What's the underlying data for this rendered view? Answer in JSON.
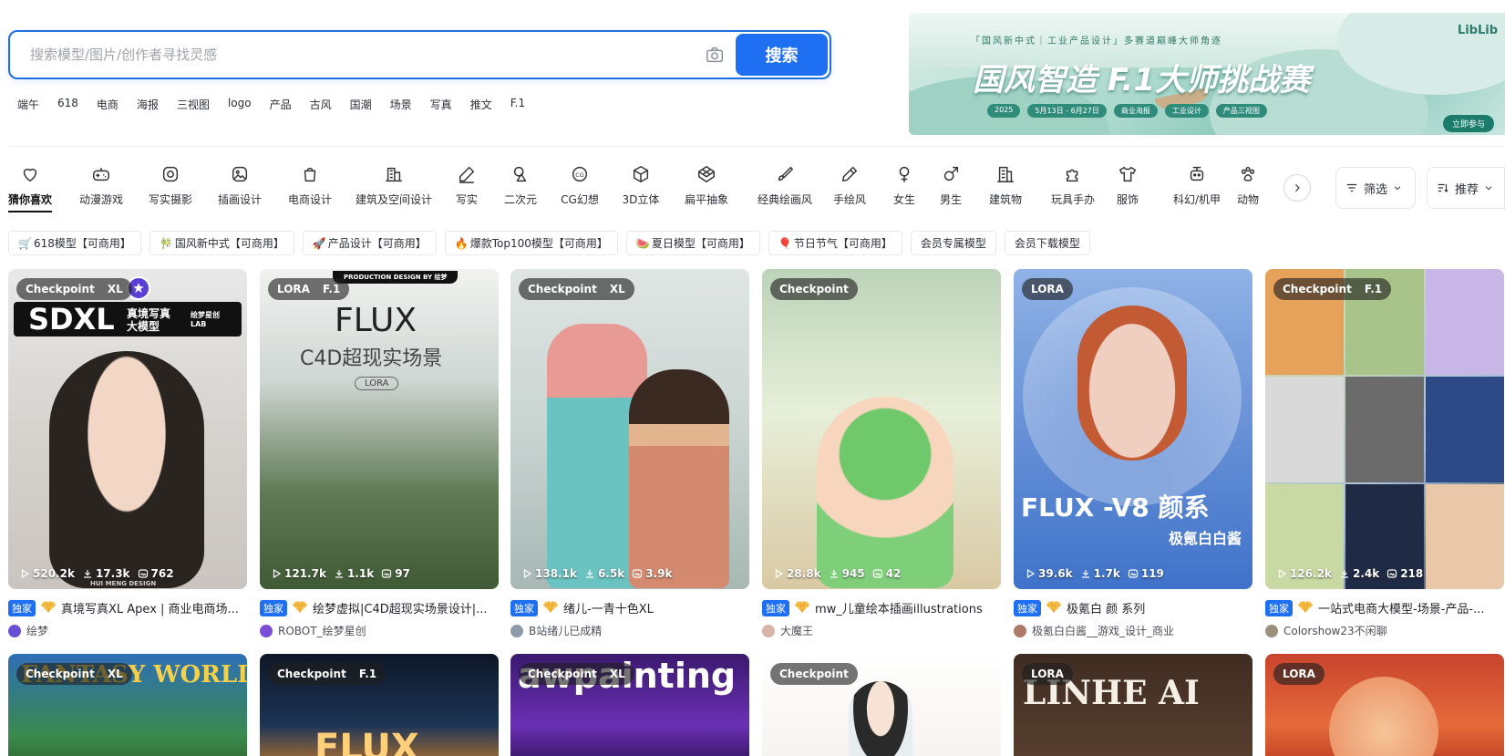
{
  "search": {
    "placeholder": "搜索模型/图片/创作者寻找灵感",
    "button": "搜索",
    "hot_words": [
      "端午",
      "618",
      "电商",
      "海报",
      "三视图",
      "logo",
      "产品",
      "古风",
      "国潮",
      "场景",
      "写真",
      "推文",
      "F.1"
    ]
  },
  "banner": {
    "top_line": "「国风新中式｜工业产品设计」多赛道巅峰大师角逐",
    "title": "国风智造 F.1大师挑战赛",
    "tags": [
      "2025",
      "5月13日 - 6月27日",
      "商业海报",
      "工业设计",
      "产品三视图"
    ],
    "logo": "LibLib",
    "cta": "立即参与"
  },
  "categories": [
    {
      "label": "猜你喜欢",
      "icon": "heart-icon",
      "active": true
    },
    {
      "label": "动漫游戏",
      "icon": "gamepad-icon"
    },
    {
      "label": "写实摄影",
      "icon": "camera-icon"
    },
    {
      "label": "插画设计",
      "icon": "picture-icon"
    },
    {
      "label": "电商设计",
      "icon": "shopping-bag-icon"
    },
    {
      "label": "建筑及空间设计",
      "icon": "building-icon"
    },
    {
      "label": "写实",
      "icon": "pencil-icon"
    },
    {
      "label": "二次元",
      "icon": "shapes-icon"
    },
    {
      "label": "CG幻想",
      "icon": "cg-icon"
    },
    {
      "label": "3D立体",
      "icon": "cube-icon"
    },
    {
      "label": "扁平抽象",
      "icon": "flat-cube-icon"
    },
    {
      "label": "经典绘画风",
      "icon": "brush-icon"
    },
    {
      "label": "手绘风",
      "icon": "pen-icon"
    },
    {
      "label": "女生",
      "icon": "female-icon"
    },
    {
      "label": "男生",
      "icon": "male-icon"
    },
    {
      "label": "建筑物",
      "icon": "office-building-icon"
    },
    {
      "label": "玩具手办",
      "icon": "puzzle-icon"
    },
    {
      "label": "服饰",
      "icon": "tshirt-icon"
    },
    {
      "label": "科幻/机甲",
      "icon": "robot-icon"
    },
    {
      "label": "动物",
      "icon": "paw-icon"
    }
  ],
  "controls": {
    "filter": "筛选",
    "sort": "推荐"
  },
  "tags": [
    {
      "emoji": "🛒",
      "label": "618模型【可商用】"
    },
    {
      "emoji": "🎋",
      "label": "国风新中式【可商用】"
    },
    {
      "emoji": "🚀",
      "label": "产品设计【可商用】"
    },
    {
      "emoji": "🔥",
      "label": "爆款Top100模型【可商用】"
    },
    {
      "emoji": "🍉",
      "label": "夏日模型【可商用】"
    },
    {
      "emoji": "🎈",
      "label": "节日节气【可商用】"
    },
    {
      "emoji": "",
      "label": "会员专属模型"
    },
    {
      "emoji": "",
      "label": "会员下载模型"
    }
  ],
  "cards": [
    {
      "badge": "Checkpoint",
      "sub": "XL",
      "views": "520.2k",
      "downloads": "17.3k",
      "likes": "762",
      "exclusive": "独家",
      "title": "真境写真XL Apex | 商业电商场...",
      "author": "绘梦",
      "img_line1": "SDXL",
      "img_line2": "真境写真 大模型",
      "img_line3": "绘梦星创 LAB",
      "img_foot": "HUI MENG DESIGN"
    },
    {
      "badge": "LORA",
      "sub": "F.1",
      "views": "121.7k",
      "downloads": "1.1k",
      "likes": "97",
      "exclusive": "独家",
      "title": "绘梦虚拟|C4D超现实场景设计|...",
      "author": "ROBOT_绘梦星创",
      "img_line1": "FLUX",
      "img_line2": "C4D超现实场景",
      "img_line3": "LORA",
      "img_foot": "PRODUCTION DESIGN BY 绘梦"
    },
    {
      "badge": "Checkpoint",
      "sub": "XL",
      "views": "138.1k",
      "downloads": "6.5k",
      "likes": "3.9k",
      "exclusive": "独家",
      "title": "绪儿-一青十色XL",
      "author": "B站绪儿已成精"
    },
    {
      "badge": "Checkpoint",
      "sub": "",
      "views": "28.8k",
      "downloads": "945",
      "likes": "42",
      "exclusive": "独家",
      "title": "mw_儿童绘本插画illustrations",
      "author": "大魔王"
    },
    {
      "badge": "LORA",
      "sub": "",
      "views": "39.6k",
      "downloads": "1.7k",
      "likes": "119",
      "exclusive": "独家",
      "title": "极氪白 颜 系列",
      "author": "极氪白白酱__游戏_设计_商业",
      "img_line1": "FLUX -V8 颜系",
      "img_line2": "极氪白白酱"
    },
    {
      "badge": "Checkpoint",
      "sub": "F.1",
      "views": "126.2k",
      "downloads": "2.4k",
      "likes": "218",
      "exclusive": "独家",
      "title": "一站式电商大模型-场景-产品-...",
      "author": "Colorshow23不闲聊"
    }
  ],
  "cards_row2": [
    {
      "badge": "Checkpoint",
      "sub": "XL",
      "img_text": "FANTASY WORLD"
    },
    {
      "badge": "Checkpoint",
      "sub": "F.1",
      "img_text": "FLUX"
    },
    {
      "badge": "Checkpoint",
      "sub": "XL",
      "img_text": "awpainting"
    },
    {
      "badge": "Checkpoint",
      "sub": "",
      "img_text": ""
    },
    {
      "badge": "LORA",
      "sub": "",
      "img_text": "LINHE AI"
    },
    {
      "badge": "LORA",
      "sub": "",
      "img_text": ""
    }
  ],
  "colors": {
    "accent": "#1f6ff2",
    "exclusive": "#1f6ff2"
  }
}
